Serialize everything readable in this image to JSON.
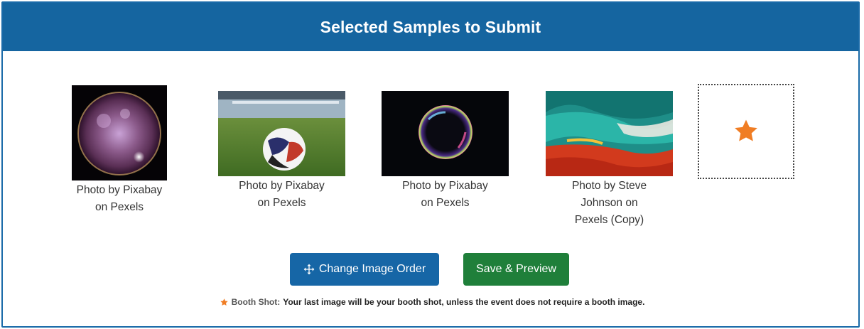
{
  "header": {
    "title": "Selected Samples to Submit"
  },
  "samples": [
    {
      "caption_line1": "Photo by Pixabay",
      "caption_line2": "on Pexels",
      "caption_line3": ""
    },
    {
      "caption_line1": "Photo by Pixabay",
      "caption_line2": "on Pexels",
      "caption_line3": ""
    },
    {
      "caption_line1": "Photo by Pixabay",
      "caption_line2": "on Pexels",
      "caption_line3": ""
    },
    {
      "caption_line1": "Photo by Steve",
      "caption_line2": "Johnson on",
      "caption_line3": "Pexels (Copy)"
    }
  ],
  "booth_slot": {
    "icon": "star-icon",
    "color": "#f07d24"
  },
  "actions": {
    "change_order_label": "Change Image Order",
    "change_order_icon": "move-arrows-icon",
    "save_preview_label": "Save & Preview"
  },
  "note": {
    "label": "Booth Shot:",
    "text": "Your last image will be your booth shot, unless the event does not require a booth image."
  },
  "colors": {
    "header_bg": "#1565a0",
    "primary_button": "#1666a6",
    "success_button": "#1f7f3a",
    "accent_star": "#f07d24"
  }
}
